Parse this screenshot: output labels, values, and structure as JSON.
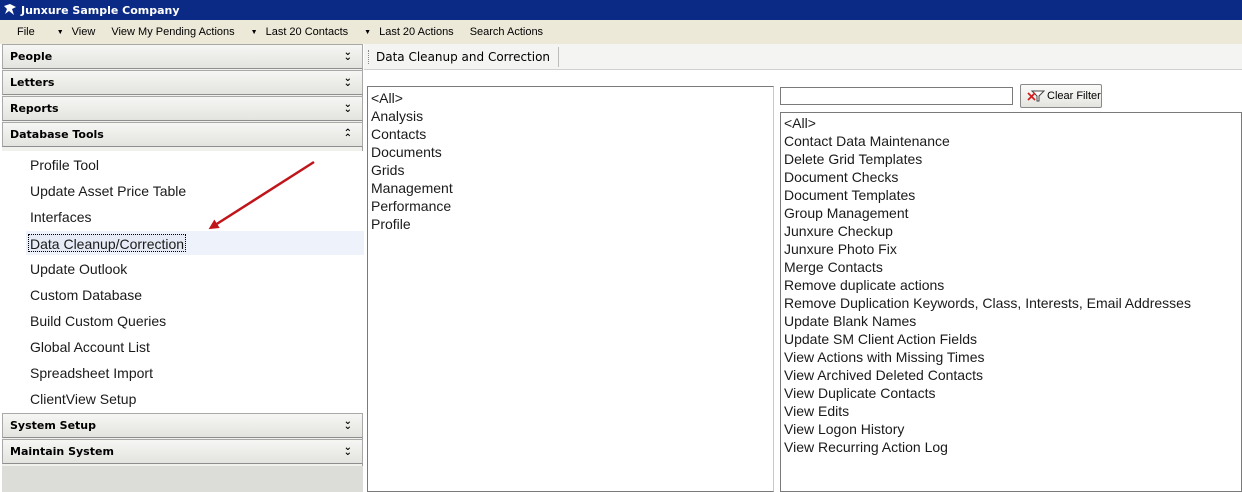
{
  "window": {
    "title": "Junxure Sample Company"
  },
  "menubar": {
    "items": [
      "File",
      "View",
      "View My Pending Actions",
      "Last 20 Contacts",
      "Last 20 Actions",
      "Search Actions"
    ]
  },
  "sidebar": {
    "sections": [
      "People",
      "Letters",
      "Reports",
      "Database Tools",
      "System Setup",
      "Maintain System"
    ],
    "database_tools": [
      "Profile Tool",
      "Update Asset Price Table",
      "Interfaces",
      "Data Cleanup/Correction",
      "Update Outlook",
      "Custom Database",
      "Build Custom Queries",
      "Global Account List",
      "Spreadsheet Import",
      "ClientView Setup"
    ],
    "selected_item": "Data Cleanup/Correction"
  },
  "tabstrip": {
    "tab_label": "Data Cleanup and Correction"
  },
  "categories": [
    "<All>",
    "Analysis",
    "Contacts",
    "Documents",
    "Grids",
    "Management",
    "Performance",
    "Profile"
  ],
  "filter": {
    "value": "",
    "clear_button_label": "Clear Filter"
  },
  "actions": [
    "<All>",
    "Contact Data Maintenance",
    "Delete Grid Templates",
    "Document Checks",
    "Document Templates",
    "Group Management",
    "Junxure Checkup",
    "Junxure Photo Fix",
    "Merge Contacts",
    "Remove duplicate actions",
    "Remove Duplication Keywords, Class, Interests, Email Addresses",
    "Update Blank Names",
    "Update SM Client Action Fields",
    "View Actions with Missing Times",
    "View Archived Deleted Contacts",
    "View Duplicate Contacts",
    "View Edits",
    "View Logon History",
    "View Recurring Action Log"
  ],
  "colors": {
    "titlebar": "#0a2a86",
    "annotation_arrow": "#c0151a"
  }
}
